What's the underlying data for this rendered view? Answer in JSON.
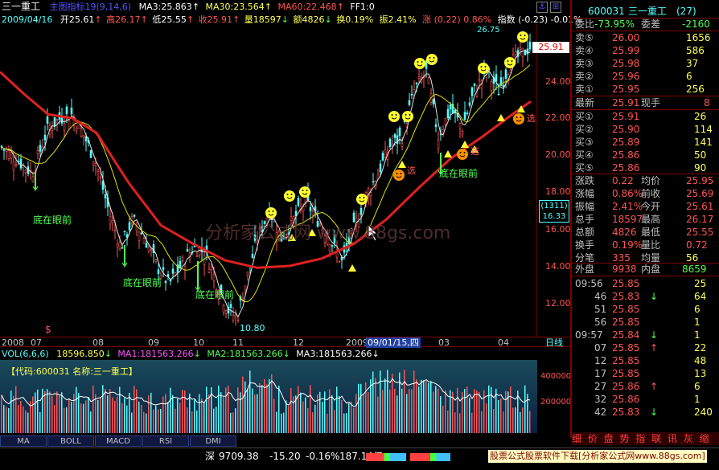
{
  "header": {
    "stock_name": "三一重工",
    "indicator_name": "主图指标19(9,14,6)",
    "ma3": "MA3:25.863",
    "ma30": "MA30:23.564",
    "ma60": "MA60:22.468",
    "ff1": "FF1:0",
    "date": "2009/04/16",
    "open": "开25.61",
    "high": "高26.17",
    "low": "低25.55",
    "close": "收25.91",
    "volume": "量18597",
    "amount": "额4826",
    "turnover": "换0.19%",
    "amplitude": "振2.41%",
    "change": "涨 (0.22) 0.86%",
    "index": "指数 (-0.23) -0.01%"
  },
  "price_axis": [
    "26.75",
    "25.91",
    "24.00",
    "22.00",
    "20.00",
    "18.00",
    "16.00",
    "14.00",
    "12.00"
  ],
  "price_axis_box": [
    "(1311)",
    "16.33"
  ],
  "date_axis": [
    "2008",
    "07",
    "08",
    "09",
    "10",
    "11",
    "12",
    "2009",
    "09/01/15,四",
    "03",
    "04"
  ],
  "date_axis_right": "日线",
  "low_marker": "10.80",
  "annotations": {
    "bottom_buy_1": "底在眼前",
    "bottom_buy_2": "底在眼前",
    "bottom_buy_3": "底在眼前",
    "bottom_buy_4": "底在眼前",
    "select_1": "选",
    "select_2": "选",
    "select_3": "选"
  },
  "watermark": "分析家公式网 www.88gs.com",
  "vol_header": {
    "label": "VOL(6,6,6)",
    "vol": "18596.850",
    "ma1": "MA1:181563.266",
    "ma2": "MA2:181563.266",
    "ma3": "MA3:181563.266"
  },
  "vol_code_label": "【代码:600031 名称:三一重工】",
  "vol_axis": [
    "400000",
    "200000"
  ],
  "tabs": [
    "MA",
    "BOLL",
    "MACD",
    "RSI",
    "DMI"
  ],
  "status": {
    "index_name": "深",
    "index_value": "9709.38",
    "index_change": "-15.20",
    "index_pct": "-0.16%",
    "index_amount": "187.14亿",
    "ad_text": "股票公式股票软件下载[分析家公式网www.88gs.com]"
  },
  "right_panel": {
    "code": "600031",
    "name": "三一重工",
    "count": "(27)",
    "weibi_label": "委比",
    "weibi_value": "-73.95%",
    "weicha_label": "委差",
    "weicha_value": "-2160",
    "asks": [
      {
        "label": "卖⑤",
        "price": "26.00",
        "vol": "1656"
      },
      {
        "label": "卖④",
        "price": "25.99",
        "vol": "586"
      },
      {
        "label": "卖③",
        "price": "25.98",
        "vol": "37"
      },
      {
        "label": "卖②",
        "price": "25.96",
        "vol": "6"
      },
      {
        "label": "卖①",
        "price": "25.95",
        "vol": "256"
      }
    ],
    "last_label": "最新",
    "last_value": "25.91",
    "hand_label": "现手",
    "hand_value": "8",
    "bids": [
      {
        "label": "买①",
        "price": "25.91",
        "vol": "26"
      },
      {
        "label": "买②",
        "price": "25.90",
        "vol": "114"
      },
      {
        "label": "买③",
        "price": "25.89",
        "vol": "141"
      },
      {
        "label": "买④",
        "price": "25.86",
        "vol": "50"
      },
      {
        "label": "买⑤",
        "price": "25.86",
        "vol": "90"
      }
    ],
    "stats": [
      {
        "l1": "涨跌",
        "v1": "0.22",
        "l2": "均价",
        "v2": "25.95"
      },
      {
        "l1": "涨幅",
        "v1": "0.86%",
        "l2": "前收",
        "v2": "25.69"
      },
      {
        "l1": "振幅",
        "v1": "2.41%",
        "l2": "今开",
        "v2": "25.61"
      },
      {
        "l1": "总手",
        "v1": "18597",
        "l2": "最高",
        "v2": "26.17"
      },
      {
        "l1": "总额",
        "v1": "4826",
        "l2": "最低",
        "v2": "25.55"
      },
      {
        "l1": "换手",
        "v1": "0.19%",
        "l2": "量比",
        "v2": "0.72"
      },
      {
        "l1": "分笔",
        "v1": "335",
        "l2": "均量",
        "v2": "56"
      }
    ],
    "outer_label": "外盘",
    "outer_value": "9938",
    "inner_label": "内盘",
    "inner_value": "8659",
    "ticks": [
      {
        "time": "09:56",
        "price": "25.85",
        "arrow": "",
        "vol": "25"
      },
      {
        "time": "46",
        "price": "25.83",
        "arrow": "↓",
        "vol": "64"
      },
      {
        "time": "51",
        "price": "25.85",
        "arrow": "",
        "vol": "6"
      },
      {
        "time": "56",
        "price": "25.85",
        "arrow": "",
        "vol": "1"
      },
      {
        "time": "09:57",
        "price": "25.84",
        "arrow": "↓",
        "vol": "1"
      },
      {
        "time": "07",
        "price": "25.85",
        "arrow": "↑",
        "vol": "22"
      },
      {
        "time": "12",
        "price": "25.85",
        "arrow": "",
        "vol": "48"
      },
      {
        "time": "17",
        "price": "25.85",
        "arrow": "",
        "vol": "13"
      },
      {
        "time": "27",
        "price": "25.86",
        "arrow": "↑",
        "vol": "6"
      },
      {
        "time": "32",
        "price": "25.86",
        "arrow": "",
        "vol": "1"
      },
      {
        "time": "42",
        "price": "25.83",
        "arrow": "↓",
        "vol": "240"
      }
    ],
    "bottom_tabs": "细 价 盘 势 指 联 讯 灰 缩"
  },
  "colors": {
    "up": "#ff5454",
    "down": "#54ffff",
    "ma_red": "#e02020",
    "ma_yellow": "#e0e000",
    "ma_white": "#e0e0e0",
    "frame": "#800000"
  }
}
